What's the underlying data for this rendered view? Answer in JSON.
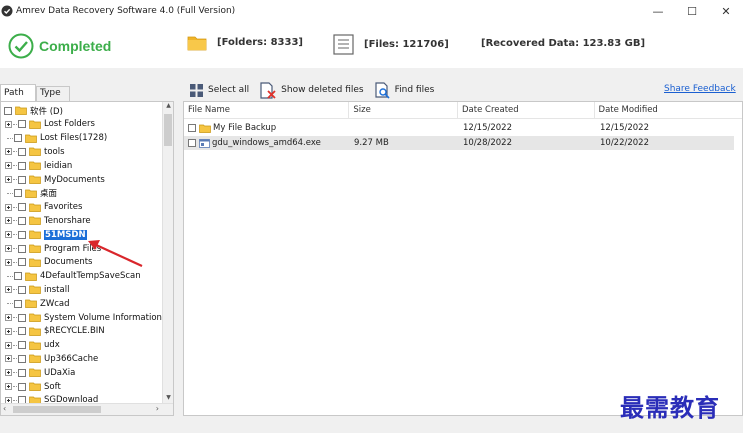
{
  "window": {
    "title": "Amrev Data Recovery Software 4.0 (Full Version)",
    "minimize": "—",
    "maximize": "☐",
    "close": "✕"
  },
  "status": {
    "completed": "Completed",
    "folders": "[Folders: 8333]",
    "files": "[Files: 121706]",
    "recovered": "[Recovered Data: 123.83 GB]",
    "accent": "#3cae4a"
  },
  "tabs": {
    "path": "Path",
    "type": "Type"
  },
  "toolbar": {
    "select_all": "Select all",
    "show_deleted": "Show deleted files",
    "find_files": "Find files",
    "share_feedback": "Share Feedback"
  },
  "tree": [
    {
      "label": "软件 (D)",
      "root": true
    },
    {
      "label": "Lost Folders",
      "expand": true
    },
    {
      "label": "Lost Files(1728)",
      "expand": false
    },
    {
      "label": "tools",
      "expand": true
    },
    {
      "label": "leidian",
      "expand": true
    },
    {
      "label": "MyDocuments",
      "expand": true
    },
    {
      "label": "桌面",
      "expand": false
    },
    {
      "label": "Favorites",
      "expand": true
    },
    {
      "label": "Tenorshare",
      "expand": true
    },
    {
      "label": "51MSDN",
      "expand": true,
      "selected": true
    },
    {
      "label": "Program Files",
      "expand": true
    },
    {
      "label": "Documents",
      "expand": true
    },
    {
      "label": "4DefaultTempSaveScan",
      "expand": false
    },
    {
      "label": "install",
      "expand": true
    },
    {
      "label": "ZWcad",
      "expand": false
    },
    {
      "label": "System Volume Information",
      "expand": true
    },
    {
      "label": "$RECYCLE.BIN",
      "expand": true
    },
    {
      "label": "udx",
      "expand": true
    },
    {
      "label": "Up366Cache",
      "expand": true
    },
    {
      "label": "UDaXia",
      "expand": true
    },
    {
      "label": "Soft",
      "expand": true
    },
    {
      "label": "SGDownload",
      "expand": true
    }
  ],
  "files": {
    "columns": [
      "File Name",
      "Size",
      "Date Created",
      "Date Modified"
    ],
    "rows": [
      {
        "name": "My File Backup",
        "size": "",
        "created": "12/15/2022",
        "modified": "12/15/2022",
        "kind": "folder"
      },
      {
        "name": "gdu_windows_amd64.exe",
        "size": "9.27 MB",
        "created": "10/28/2022",
        "modified": "10/22/2022",
        "kind": "exe"
      }
    ]
  },
  "watermark": "最需教育"
}
